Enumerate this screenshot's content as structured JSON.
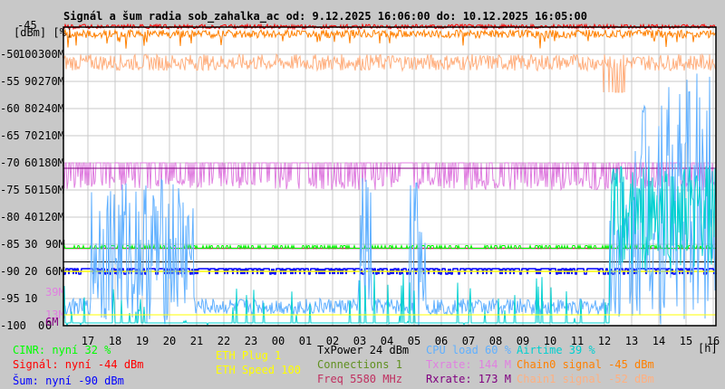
{
  "chart_data": {
    "type": "line",
    "title": "Signál a šum radia sob_zahalka_ac od: 9.12.2025 16:06:00 do: 10.12.2025 16:05:00",
    "y_units_label": "[dBm] [%]",
    "x_unit": "[h]",
    "x_ticks": [
      "17",
      "18",
      "19",
      "20",
      "21",
      "22",
      "23",
      "00",
      "01",
      "02",
      "03",
      "04",
      "05",
      "06",
      "07",
      "08",
      "09",
      "10",
      "11",
      "12",
      "13",
      "14",
      "15",
      "16"
    ],
    "y_ticks_dbm": [
      "-45",
      "-50",
      "-55",
      "-60",
      "-65",
      "-70",
      "-75",
      "-80",
      "-85",
      "-90",
      "-95",
      "-100"
    ],
    "y_ticks_pct": [
      "",
      "100",
      "90",
      "80",
      "70",
      "60",
      "50",
      "40",
      "30",
      "20",
      "10",
      "0"
    ],
    "y_ticks_rate": [
      "",
      "300M",
      "270M",
      "240M",
      "210M",
      "180M",
      "150M",
      "120M",
      "90M",
      "60M",
      "",
      "0"
    ],
    "rate_markers": [
      {
        "label": "39M",
        "color": "#e080e0"
      },
      {
        "label": "13M",
        "color": "#e080e0"
      },
      {
        "label": "6M",
        "color": "#800080"
      }
    ],
    "ylim_dbm": [
      -100,
      -45
    ],
    "ylim_pct": [
      0,
      110
    ],
    "grid": true,
    "series": [
      {
        "name": "Signál",
        "color": "#ff0000",
        "unit": "dBm",
        "typical": -44
      },
      {
        "name": "Chain0 signal",
        "color": "#ff8000",
        "unit": "dBm",
        "typical": -45
      },
      {
        "name": "Chain1 signal",
        "color": "#ffb080",
        "unit": "dBm",
        "typical": -52
      },
      {
        "name": "Šum",
        "color": "#0000ff",
        "unit": "dBm",
        "typical": -90
      },
      {
        "name": "CINR",
        "color": "#00ff00",
        "unit": "%",
        "typical": 32
      },
      {
        "name": "Txrate",
        "color": "#e080e0",
        "unit": "M",
        "typical": 144
      },
      {
        "name": "Rxrate",
        "color": "#800080",
        "unit": "M",
        "typical": 173
      },
      {
        "name": "CPU load",
        "color": "#60b0ff",
        "unit": "%",
        "typical": 60
      },
      {
        "name": "Airtime",
        "color": "#00d0d0",
        "unit": "%",
        "typical": 39
      },
      {
        "name": "TxPower",
        "color": "#000000",
        "unit": "dBm",
        "typical": 24
      },
      {
        "name": "ETH Speed",
        "color": "#ffff00",
        "typical": 100
      },
      {
        "name": "Freq",
        "color": "#c03060",
        "typical": 5580
      }
    ]
  },
  "legend": {
    "cinr": "CINR: nyní 32 %",
    "signal": "Signál: nyní -44 dBm",
    "noise": "Šum: nyní -90 dBm",
    "eth_plug": "ETH Plug 1",
    "eth_speed": "ETH Speed 100",
    "txpower": "TxPower 24 dBm",
    "connections": "Connections 1",
    "freq": "Freq 5580 MHz",
    "cpu": "CPU load 60 %",
    "txrate": "Txrate: 144 M",
    "rxrate": "Rxrate: 173 M",
    "airtime": "Airtime 39 %",
    "chain0": "Chain0 signal -45 dBm",
    "chain1": "Chain1 signal -52 dBm"
  }
}
